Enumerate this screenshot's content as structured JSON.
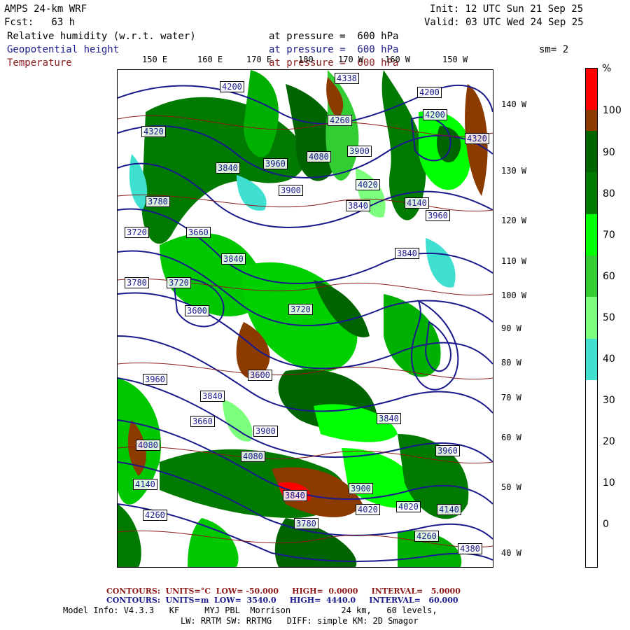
{
  "header": {
    "model": "AMPS 24-km WRF",
    "init": "Init: 12 UTC Sun 21 Sep 25",
    "fcst": "Fcst:   63 h",
    "valid": "Valid: 03 UTC Wed 24 Sep 25"
  },
  "fields": [
    {
      "name": "Relative humidity (w.r.t. water)",
      "level": "at pressure =  600 hPa",
      "color": "#000000"
    },
    {
      "name": "Geopotential height",
      "level": "at pressure =  600 hPa",
      "color": "#1a1a8c"
    },
    {
      "name": "Temperature",
      "level": "at pressure =  600 hPa",
      "color": "#8b1a1a"
    }
  ],
  "smoothing": "sm= 2",
  "lon_labels": [
    "150 E",
    "160 E",
    "170 E",
    "180",
    "170 W",
    "160 W",
    "150 W"
  ],
  "lat_labels": [
    "140 W",
    "130 W",
    "120 W",
    "110 W",
    "100 W",
    "90 W",
    "80 W",
    "70 W",
    "60 W",
    "50 W",
    "40 W"
  ],
  "legend": {
    "unit": "%",
    "labels": [
      "100",
      "90",
      "80",
      "70",
      "60",
      "50",
      "40",
      "30",
      "20",
      "10",
      "0"
    ],
    "bands": [
      {
        "from": 95,
        "to": 100,
        "color": "#ff0000"
      },
      {
        "from": 90,
        "to": 95,
        "color": "#8b3a00"
      },
      {
        "from": 80,
        "to": 90,
        "color": "#006400"
      },
      {
        "from": 70,
        "to": 80,
        "color": "#007a00"
      },
      {
        "from": 60,
        "to": 70,
        "color": "#00ff00"
      },
      {
        "from": 50,
        "to": 60,
        "color": "#32cd32"
      },
      {
        "from": 40,
        "to": 50,
        "color": "#7cff7c"
      },
      {
        "from": 30,
        "to": 40,
        "color": "#40e0d0"
      },
      {
        "from": 0,
        "to": 30,
        "color": "#ffffff"
      }
    ]
  },
  "contour_labels": [
    "4200",
    "4338",
    "4200",
    "4320",
    "4260",
    "4200",
    "4320",
    "3960",
    "4080",
    "3900",
    "3780",
    "4020",
    "3840",
    "3900",
    "4140",
    "3840",
    "3720",
    "3660",
    "3840",
    "3780",
    "3720",
    "3840",
    "3600",
    "3720",
    "3960",
    "3840",
    "3660",
    "3600",
    "3900",
    "3960",
    "3840",
    "4080",
    "4020",
    "3900",
    "4080",
    "4260",
    "4260",
    "4380",
    "4140",
    "4020",
    "4140",
    "3780",
    "3960",
    "3840"
  ],
  "footer": {
    "temp_contours": "CONTOURS:  UNITS=°C  LOW= -50.000     HIGH=  0.0000     INTERVAL=   5.0000",
    "hgt_contours": "CONTOURS:  UNITS=m  LOW=  3540.0     HIGH=  4440.0     INTERVAL=   60.000",
    "model_info_1": "Model Info: V4.3.3   KF     MYJ PBL  Morrison          24 km,   60 levels,",
    "model_info_2": "LW: RRTM SW: RRTMG   DIFF: simple KM: 2D Smagor"
  }
}
